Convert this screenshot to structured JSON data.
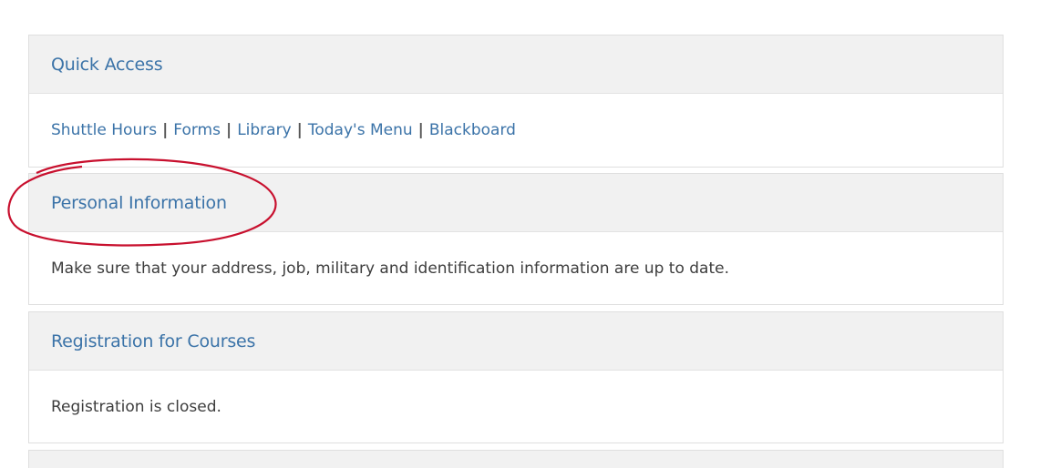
{
  "quick_access": {
    "title": "Quick Access",
    "links": [
      "Shuttle Hours",
      "Forms",
      "Library",
      "Today's Menu",
      "Blackboard"
    ],
    "separator": "|"
  },
  "personal_information": {
    "title": "Personal Information",
    "body": "Make sure that your address, job, military and identification information are up to date."
  },
  "registration": {
    "title": "Registration for Courses",
    "body": "Registration is closed."
  },
  "annotation": {
    "color": "#c8102e",
    "shape": "ellipse"
  },
  "colors": {
    "link": "#3b73a8",
    "header_bg": "#f1f1f1",
    "border": "#dfdfdf",
    "text": "#3d3d3d"
  }
}
